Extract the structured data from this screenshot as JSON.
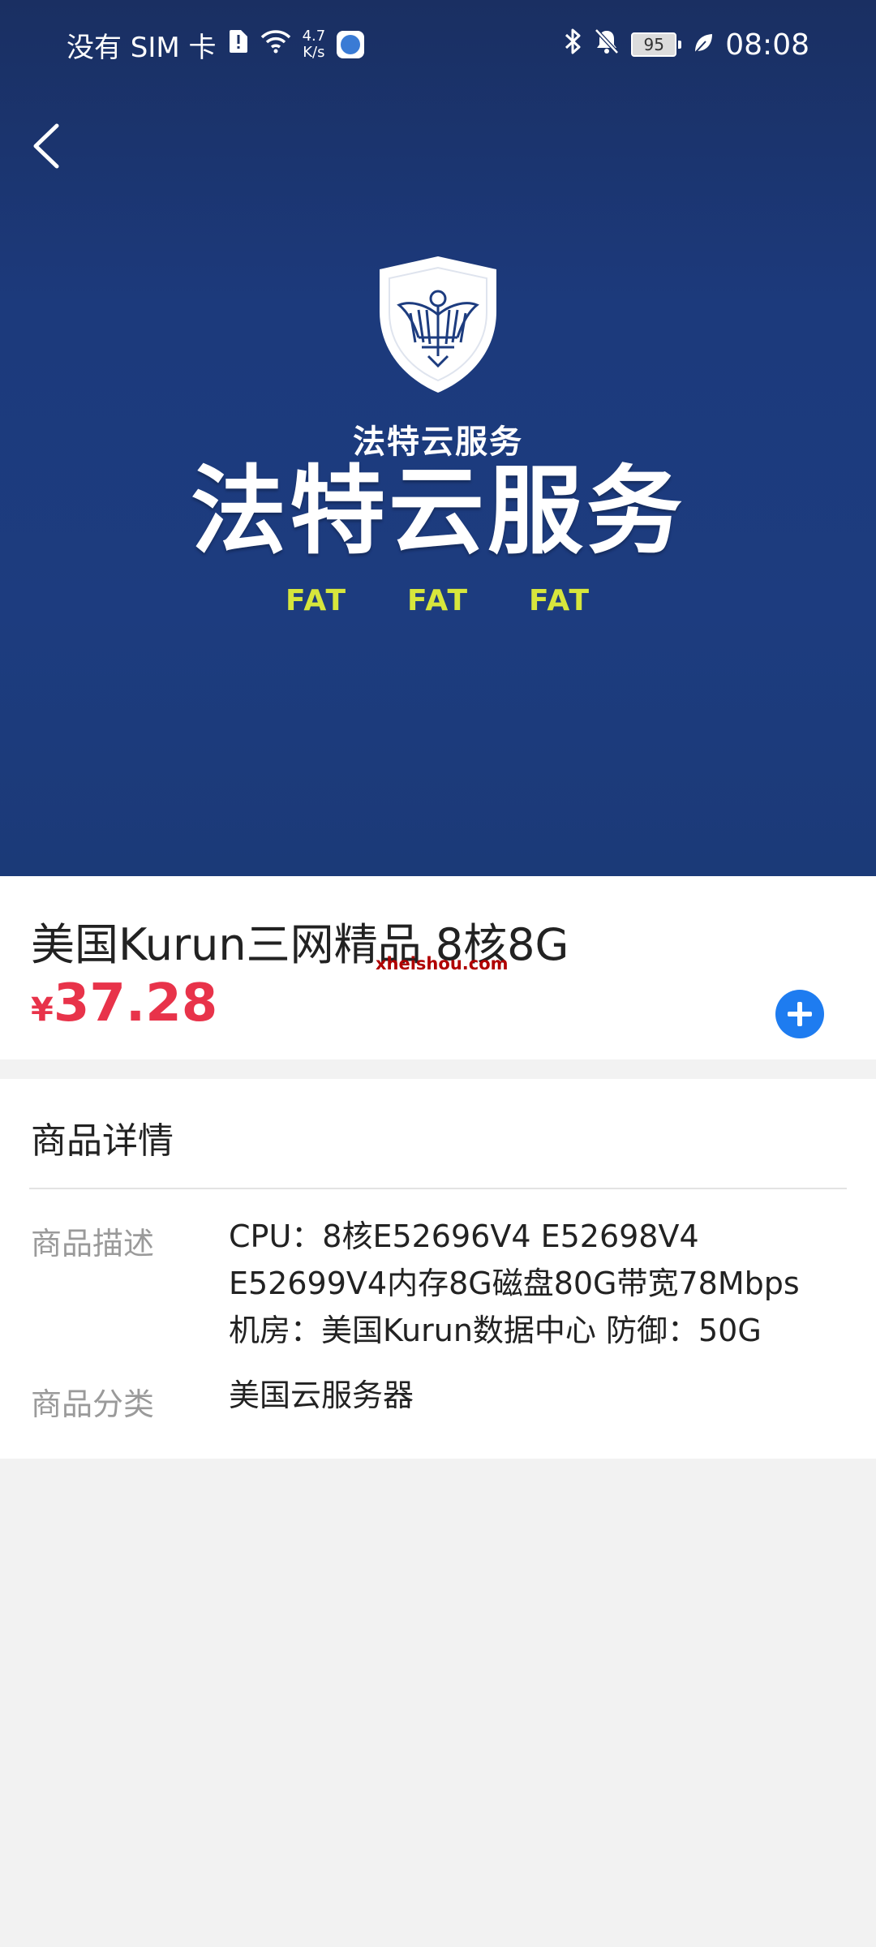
{
  "status_bar": {
    "carrier": "没有 SIM 卡",
    "speed_value": "4.7",
    "speed_unit": "K/s",
    "battery": "95",
    "time": "08:08"
  },
  "hero": {
    "brand_small": "法特云服务",
    "brand_big": "法特云服务",
    "tags": [
      "FAT",
      "FAT",
      "FAT"
    ]
  },
  "product": {
    "title": "美国Kurun三网精品 8核8G",
    "watermark": "xheishou.com",
    "currency": "¥",
    "price": "37.28"
  },
  "details": {
    "title": "商品详情",
    "desc_label": "商品描述",
    "desc_lines": [
      "CPU：8核E52696V4 E52698V4",
      "E52699V4内存8G磁盘80G带宽78Mbps",
      "机房：美国Kurun数据中心 防御：50G"
    ],
    "category_label": "商品分类",
    "category_value": "美国云服务器"
  },
  "colors": {
    "hero_bg": "#1c3a7c",
    "price": "#e8334a",
    "accent": "#1e7cf0",
    "tag_yellow": "#d7e63c"
  }
}
